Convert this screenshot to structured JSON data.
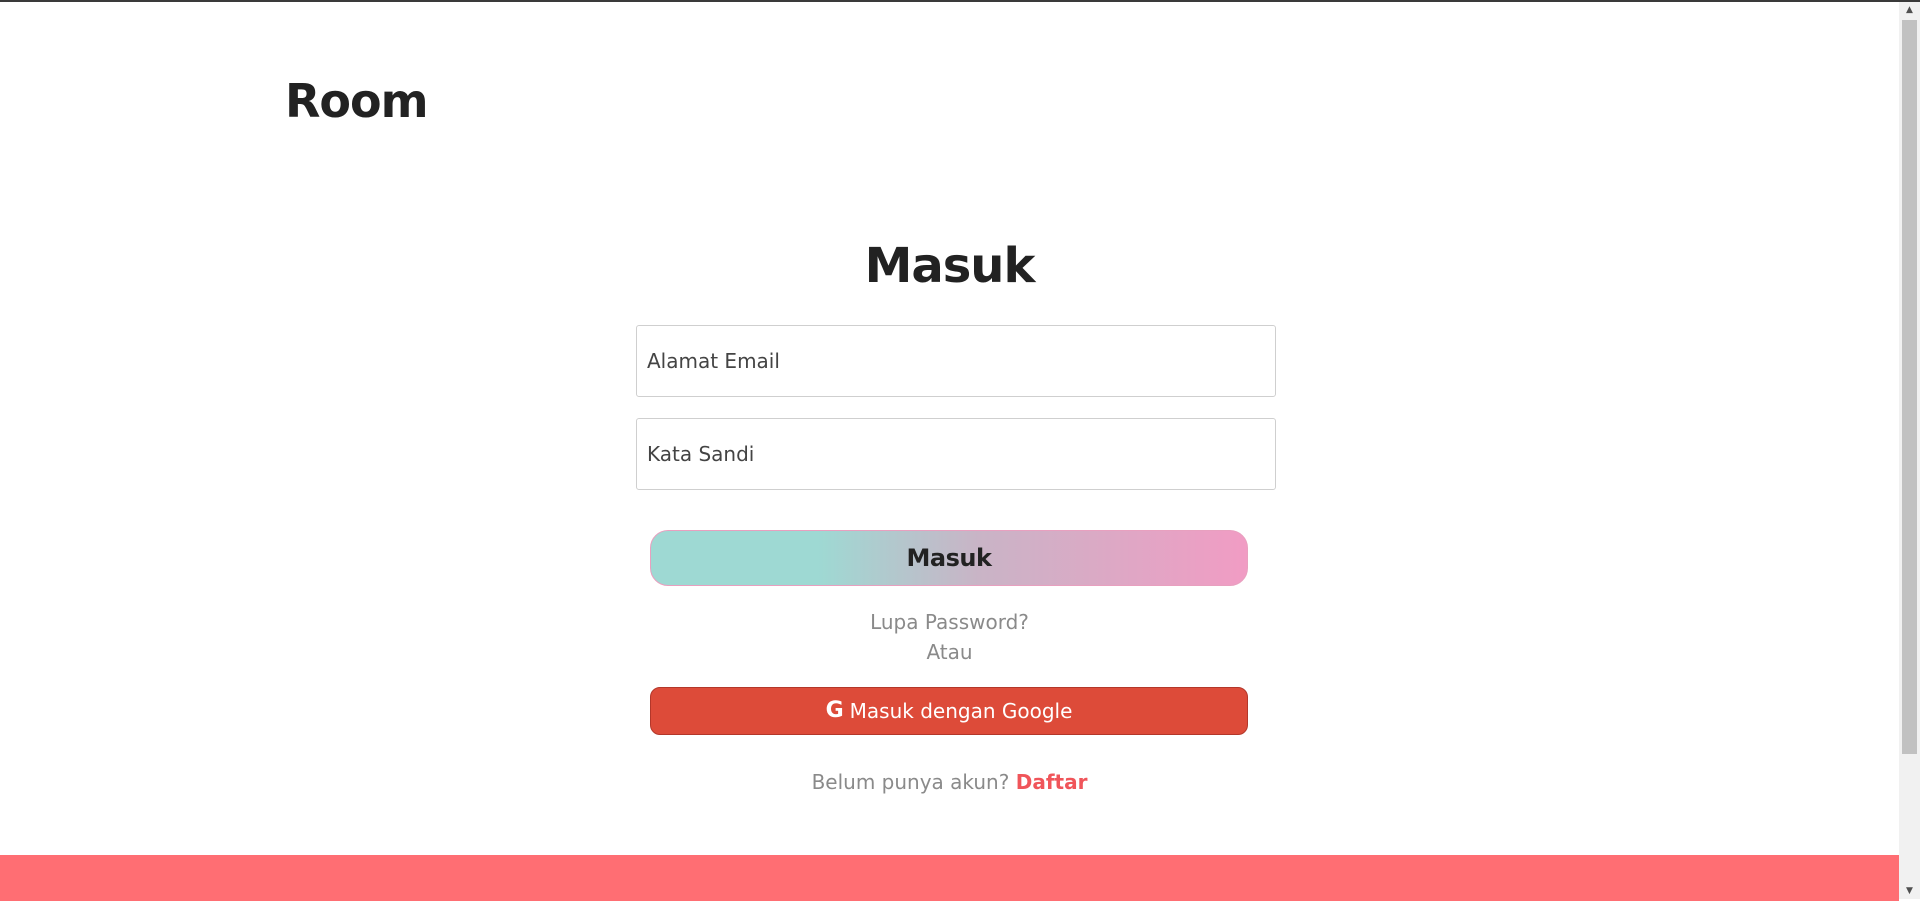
{
  "header": {
    "brand": "Room"
  },
  "login_form": {
    "title": "Masuk",
    "email_placeholder": "Alamat Email",
    "password_placeholder": "Kata Sandi",
    "submit_label": "Masuk",
    "forgot_password": "Lupa Password?",
    "separator": "Atau",
    "google_label": "Masuk dengan Google",
    "google_icon": "G",
    "signup_prompt": "Belum punya akun?",
    "signup_link": "Daftar"
  },
  "colors": {
    "login_gradient_start": "#9ed9d3",
    "login_gradient_end": "#f19cc4",
    "google_button": "#dd4b39",
    "signup_link": "#f0555a",
    "footer_band": "#ff6e73"
  },
  "icons": {
    "google": "google-icon",
    "scroll_up": "scroll-up-arrow-icon",
    "scroll_down": "scroll-down-arrow-icon"
  }
}
